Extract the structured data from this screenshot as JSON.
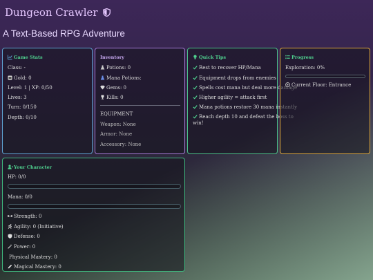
{
  "header": {
    "title": "Dungeon Crawler",
    "subtitle": "A Text-Based RPG Adventure"
  },
  "colors": {
    "stats_border": "#5fa4d4",
    "inventory_border": "#a57ad6",
    "tips_border": "#4cc48a",
    "progress_border": "#e0a93c",
    "character_border": "#3fb87e",
    "accent_green": "#4fd08e"
  },
  "game_stats": {
    "title": "Game Stats",
    "class_label": "Class: -",
    "gold_label": "Gold: 0",
    "level_label": "Level: 1 | XP: 0/50",
    "lives_label": "Lives: 3",
    "turn_label": "Turn: 0/150",
    "depth_label": "Depth: 0/10"
  },
  "inventory": {
    "title": "Inventory",
    "potions_label": "Potions: 0",
    "mana_potions_label": "Mana Potions:",
    "gems_label": "Gems: 0",
    "kills_label": "Kills: 0",
    "equipment_heading": "EQUIPMENT",
    "weapon_label": "Weapon: None",
    "armor_label": "Armor: None",
    "accessory_label": "Accessory: None"
  },
  "tips": {
    "title": "Quick Tips",
    "items": [
      "Rest to recover HP/Mana",
      "Equipment drops from enemies",
      "Spells cost mana but deal more damage",
      "Higher agility = attack first",
      "Mana potions restore 30 mana instantly",
      "Reach depth 10 and defeat the boss to",
      "win!"
    ]
  },
  "progress": {
    "title": "Progress",
    "exploration_label": "Exploration: 0%",
    "exploration_value": 0,
    "floor_label": "Current Floor: Entrance"
  },
  "character": {
    "title": "Your Character",
    "hp_label": "HP: 0/0",
    "hp_value": 0,
    "mana_label": "Mana: 0/0",
    "mana_value": 0,
    "strength_label": "Strength: 0",
    "agility_label": "Agility: 0 (Initiative)",
    "defense_label": "Defense: 0",
    "power_label": "Power: 0",
    "physical_mastery_label": "Physical Mastery: 0",
    "magical_mastery_label": "Magical Mastery: 0"
  }
}
